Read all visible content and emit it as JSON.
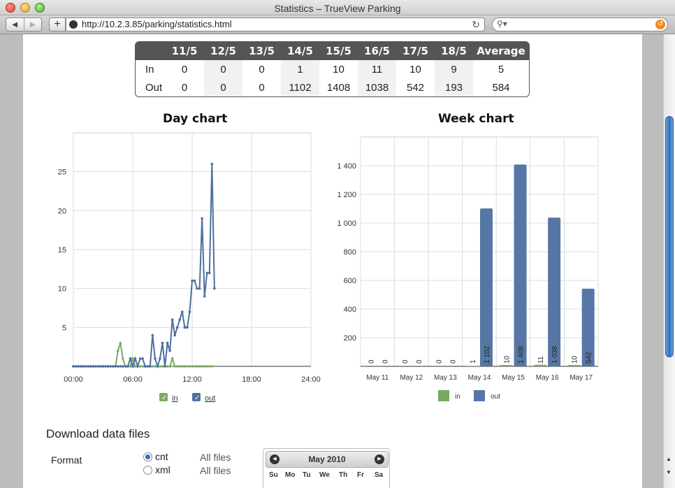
{
  "window": {
    "title": "Statistics – TrueView Parking"
  },
  "toolbar": {
    "url": "http://10.2.3.85/parking/statistics.html",
    "add_label": "+",
    "back_icon": "back-arrow-icon",
    "forward_icon": "forward-arrow-icon"
  },
  "stats_table": {
    "headers": [
      "",
      "11/5",
      "12/5",
      "13/5",
      "14/5",
      "15/5",
      "16/5",
      "17/5",
      "18/5",
      "Average"
    ],
    "rows": [
      {
        "label": "In",
        "values": [
          "0",
          "0",
          "0",
          "1",
          "10",
          "11",
          "10",
          "9",
          "5"
        ]
      },
      {
        "label": "Out",
        "values": [
          "0",
          "0",
          "0",
          "1102",
          "1408",
          "1038",
          "542",
          "193",
          "584"
        ]
      }
    ]
  },
  "day_chart": {
    "title": "Day chart",
    "legend": {
      "in": "in",
      "out": "out"
    }
  },
  "week_chart": {
    "title": "Week chart",
    "legend": {
      "in": "in",
      "out": "out"
    }
  },
  "chart_data": [
    {
      "type": "line",
      "title": "Day chart",
      "xlabel": "",
      "ylabel": "",
      "xticks": [
        "00:00",
        "06:00",
        "12:00",
        "18:00",
        "24:00"
      ],
      "yticks": [
        "5",
        "10",
        "15",
        "20",
        "25"
      ],
      "xlim": [
        0,
        24
      ],
      "ylim": [
        0,
        30
      ],
      "grid": true,
      "legend": "bottom",
      "series": [
        {
          "name": "in",
          "color": "#7aab67",
          "points": [
            [
              0,
              0
            ],
            [
              0.25,
              0
            ],
            [
              0.5,
              0
            ],
            [
              0.75,
              0
            ],
            [
              1,
              0
            ],
            [
              1.25,
              0
            ],
            [
              1.5,
              0
            ],
            [
              1.75,
              0
            ],
            [
              2,
              0
            ],
            [
              2.25,
              0
            ],
            [
              2.5,
              0
            ],
            [
              2.75,
              0
            ],
            [
              3,
              0
            ],
            [
              3.25,
              0
            ],
            [
              3.5,
              0
            ],
            [
              3.75,
              0
            ],
            [
              4,
              0
            ],
            [
              4.25,
              0
            ],
            [
              4.5,
              2
            ],
            [
              4.75,
              3
            ],
            [
              5,
              1
            ],
            [
              5.25,
              0
            ],
            [
              5.5,
              0
            ],
            [
              5.75,
              0
            ],
            [
              6,
              1
            ],
            [
              6.25,
              0
            ],
            [
              6.5,
              0
            ],
            [
              6.75,
              0
            ],
            [
              7,
              0
            ],
            [
              7.25,
              0
            ],
            [
              7.5,
              0
            ],
            [
              7.75,
              0
            ],
            [
              8,
              0
            ],
            [
              8.25,
              0
            ],
            [
              8.5,
              0
            ],
            [
              8.75,
              0
            ],
            [
              9,
              0
            ],
            [
              9.25,
              0
            ],
            [
              9.5,
              0
            ],
            [
              9.75,
              0
            ],
            [
              10,
              1
            ],
            [
              10.25,
              0
            ],
            [
              10.5,
              0
            ],
            [
              10.75,
              0
            ],
            [
              11,
              0
            ],
            [
              11.25,
              0
            ],
            [
              11.5,
              0
            ],
            [
              11.75,
              0
            ],
            [
              12,
              0
            ],
            [
              12.25,
              0
            ],
            [
              12.5,
              0
            ],
            [
              12.75,
              0
            ],
            [
              13,
              0
            ],
            [
              13.25,
              0
            ],
            [
              13.5,
              0
            ],
            [
              13.75,
              0
            ],
            [
              14,
              0
            ]
          ]
        },
        {
          "name": "out",
          "color": "#4e6f9e",
          "points": [
            [
              0,
              0
            ],
            [
              0.25,
              0
            ],
            [
              0.5,
              0
            ],
            [
              0.75,
              0
            ],
            [
              1,
              0
            ],
            [
              1.25,
              0
            ],
            [
              1.5,
              0
            ],
            [
              1.75,
              0
            ],
            [
              2,
              0
            ],
            [
              2.25,
              0
            ],
            [
              2.5,
              0
            ],
            [
              2.75,
              0
            ],
            [
              3,
              0
            ],
            [
              3.25,
              0
            ],
            [
              3.5,
              0
            ],
            [
              3.75,
              0
            ],
            [
              4,
              0
            ],
            [
              4.25,
              0
            ],
            [
              4.5,
              0
            ],
            [
              4.75,
              0
            ],
            [
              5,
              0
            ],
            [
              5.25,
              0
            ],
            [
              5.5,
              0
            ],
            [
              5.75,
              1
            ],
            [
              6,
              0
            ],
            [
              6.25,
              1
            ],
            [
              6.5,
              0
            ],
            [
              6.75,
              1
            ],
            [
              7,
              1
            ],
            [
              7.25,
              0
            ],
            [
              7.5,
              0
            ],
            [
              7.75,
              0
            ],
            [
              8,
              4
            ],
            [
              8.25,
              1
            ],
            [
              8.5,
              0
            ],
            [
              8.75,
              1
            ],
            [
              9,
              3
            ],
            [
              9.25,
              0
            ],
            [
              9.5,
              3
            ],
            [
              9.75,
              2
            ],
            [
              10,
              6
            ],
            [
              10.25,
              4
            ],
            [
              10.5,
              5
            ],
            [
              10.75,
              6
            ],
            [
              11,
              7
            ],
            [
              11.25,
              5
            ],
            [
              11.5,
              5
            ],
            [
              11.75,
              7
            ],
            [
              12,
              11
            ],
            [
              12.25,
              11
            ],
            [
              12.5,
              10
            ],
            [
              12.75,
              10
            ],
            [
              13,
              19
            ],
            [
              13.25,
              9
            ],
            [
              13.5,
              12
            ],
            [
              13.75,
              12
            ],
            [
              14,
              26
            ],
            [
              14.25,
              10
            ]
          ]
        }
      ]
    },
    {
      "type": "bar",
      "title": "Week chart",
      "categories": [
        "May 11",
        "May 12",
        "May 13",
        "May 14",
        "May 15",
        "May 16",
        "May 17"
      ],
      "yticks": [
        "200",
        "400",
        "600",
        "800",
        "1 000",
        "1 200",
        "1 400"
      ],
      "ylim": [
        0,
        1600
      ],
      "grid": true,
      "legend": "bottom",
      "series": [
        {
          "name": "in",
          "color": "#77aa66",
          "values": [
            0,
            0,
            0,
            1,
            10,
            11,
            10
          ],
          "labels": [
            "0",
            "0",
            "0",
            "1",
            "10",
            "11",
            "10"
          ]
        },
        {
          "name": "out",
          "color": "#5677a5",
          "values": [
            0,
            0,
            0,
            1102,
            1408,
            1038,
            542
          ],
          "labels": [
            "0",
            "0",
            "0",
            "1 102",
            "1 408",
            "1 038",
            "542"
          ]
        }
      ]
    }
  ],
  "download": {
    "title": "Download data files",
    "format_label": "Format",
    "options": [
      {
        "label": "cnt",
        "selected": true,
        "all_files": "All files"
      },
      {
        "label": "xml",
        "selected": false,
        "all_files": "All files"
      }
    ],
    "calendar": {
      "month": "May 2010",
      "days": [
        "Su",
        "Mo",
        "Tu",
        "We",
        "Th",
        "Fr",
        "Sa"
      ]
    }
  }
}
